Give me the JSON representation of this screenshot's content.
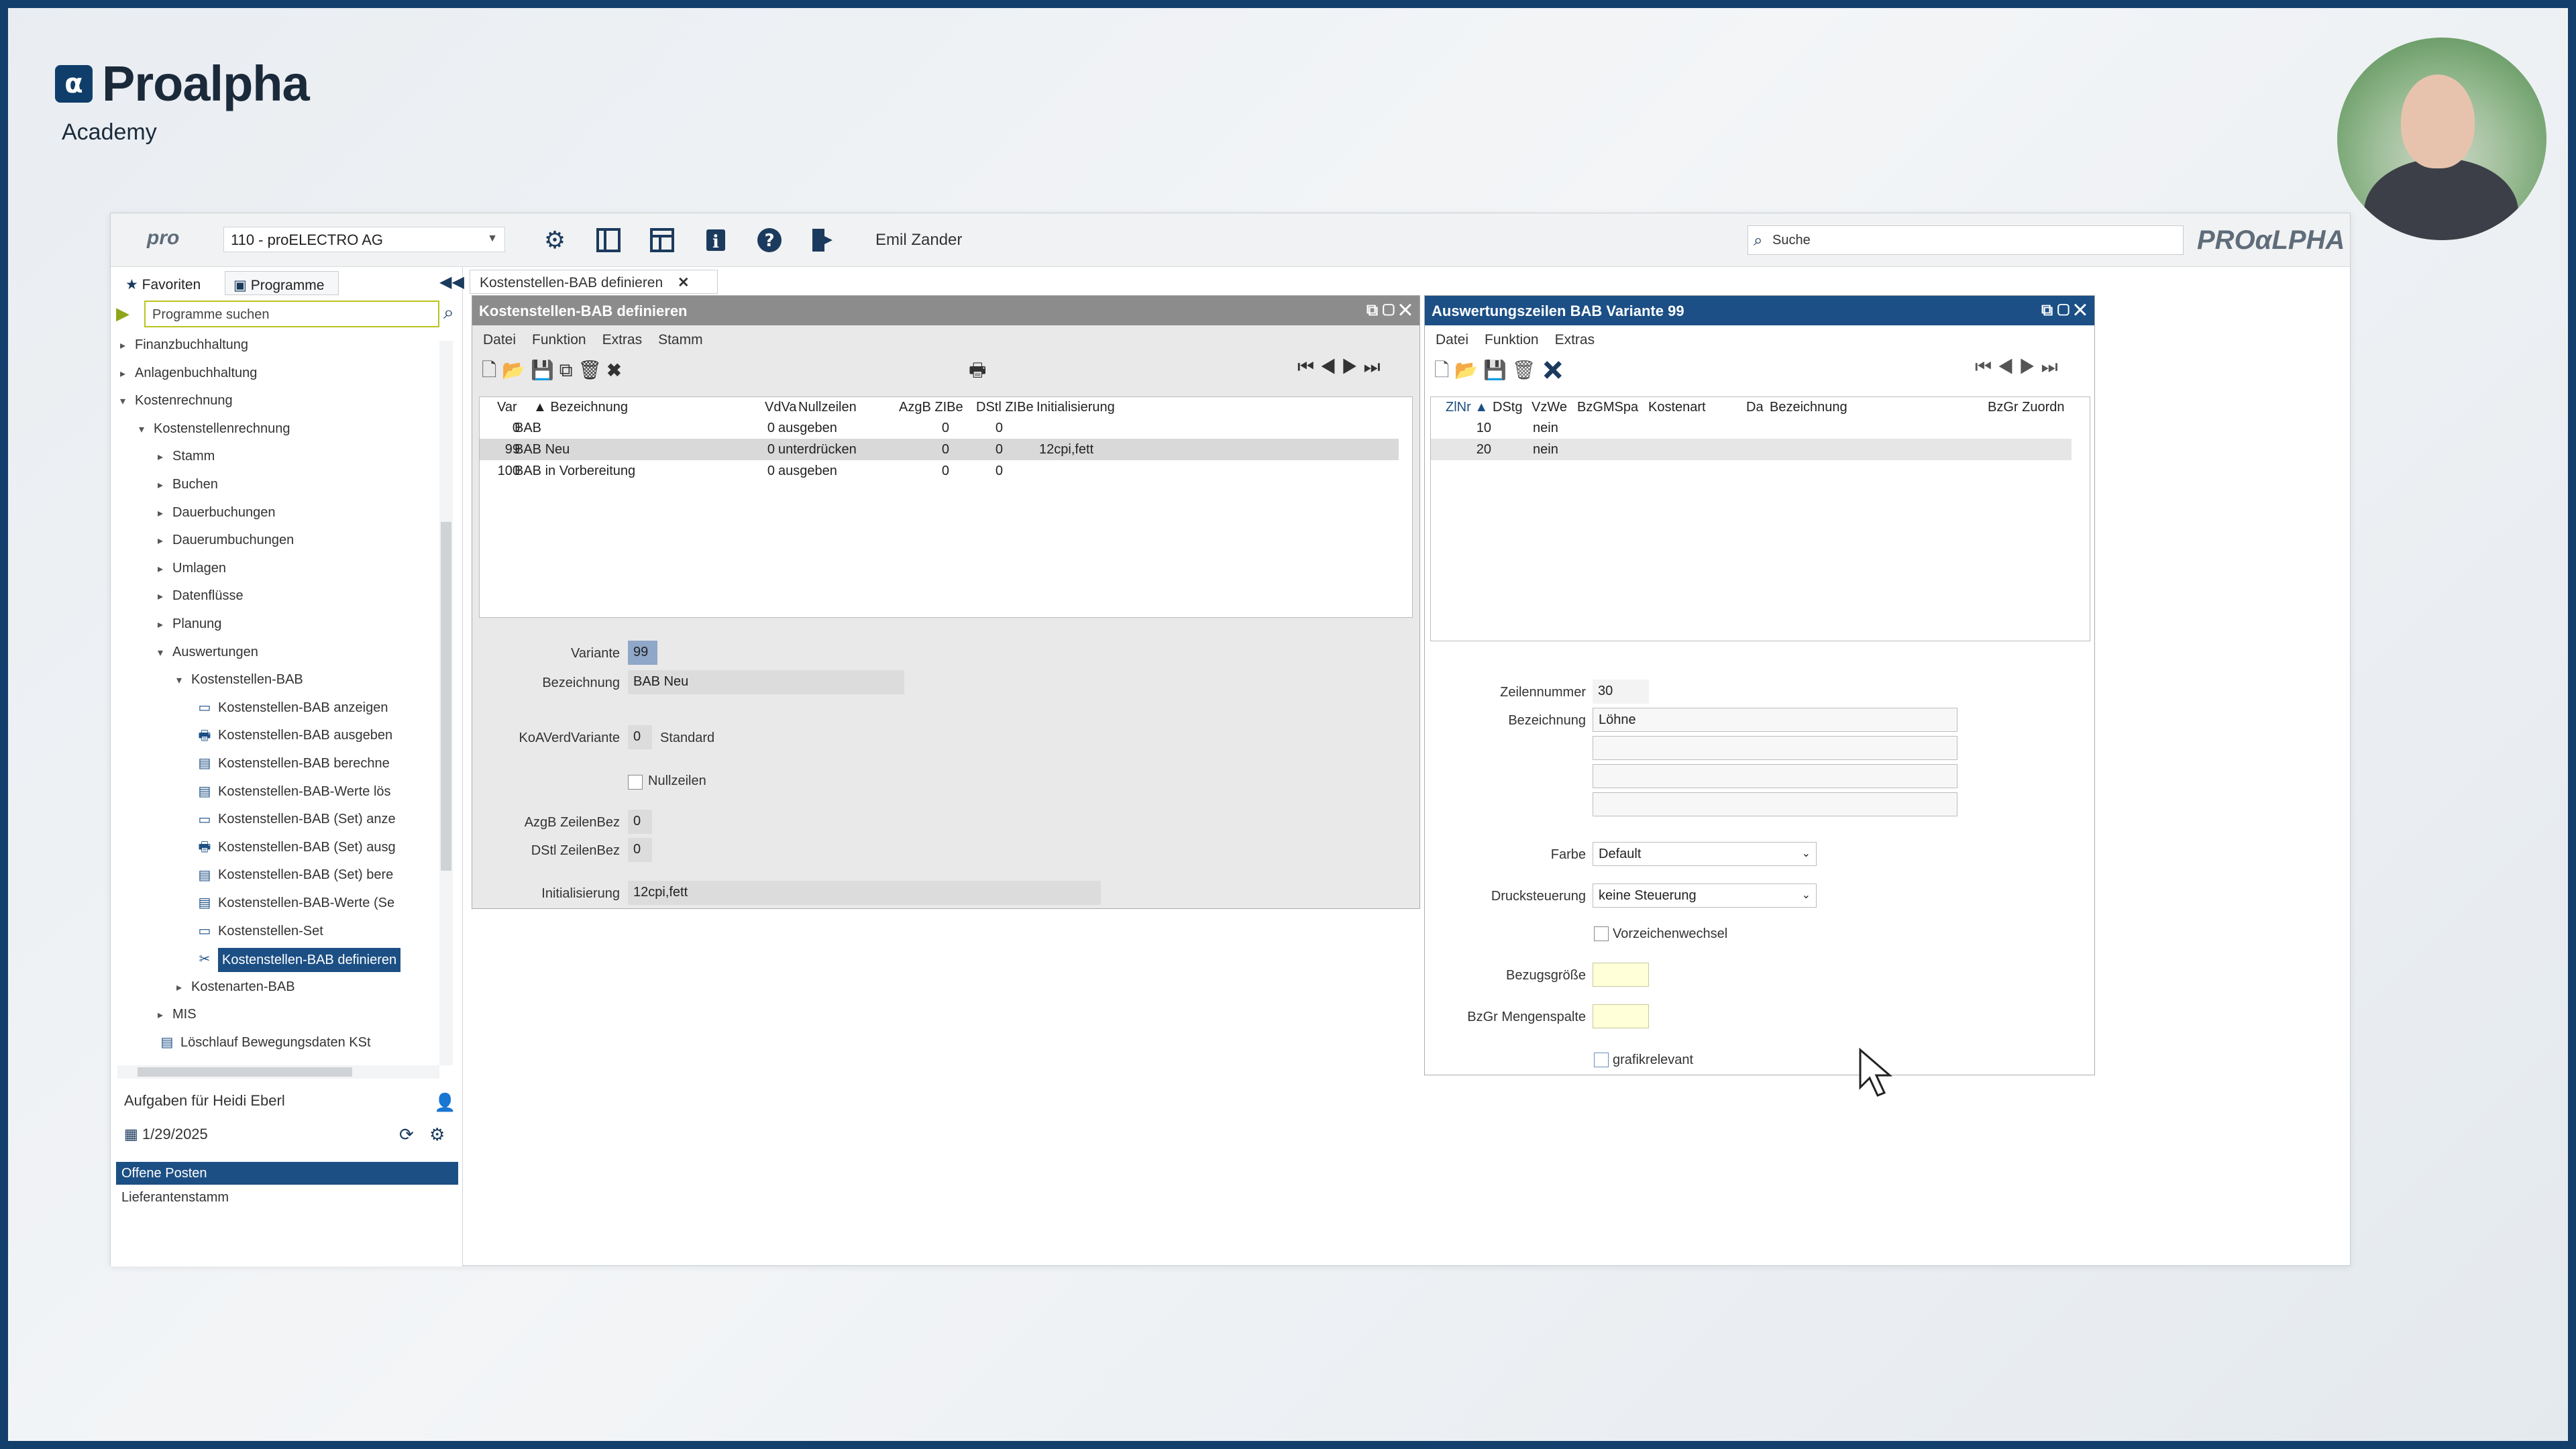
{
  "branding": {
    "logo_text": "Proalpha",
    "logo_mark": "α",
    "subtitle": "Academy"
  },
  "app": {
    "logo_small": "pro",
    "company": "110 - proELECTRO AG",
    "user": "Emil Zander",
    "search_placeholder": "Suche",
    "brand": "PROαLPHA",
    "icons": [
      "gear-icon",
      "panel-icon",
      "layout-icon",
      "info-icon",
      "help-icon",
      "exit-icon"
    ]
  },
  "sidebar": {
    "tabs": [
      "Favoriten",
      "Programme"
    ],
    "search_placeholder": "Programme suchen",
    "tree": [
      {
        "label": "Finanzbuchhaltung",
        "level": 0,
        "arrow": "▸"
      },
      {
        "label": "Anlagenbuchhaltung",
        "level": 0,
        "arrow": "▸"
      },
      {
        "label": "Kostenrechnung",
        "level": 0,
        "arrow": "▾"
      },
      {
        "label": "Kostenstellenrechnung",
        "level": 1,
        "arrow": "▾"
      },
      {
        "label": "Stamm",
        "level": 2,
        "arrow": "▸"
      },
      {
        "label": "Buchen",
        "level": 2,
        "arrow": "▸"
      },
      {
        "label": "Dauerbuchungen",
        "level": 2,
        "arrow": "▸"
      },
      {
        "label": "Dauerumbuchungen",
        "level": 2,
        "arrow": "▸"
      },
      {
        "label": "Umlagen",
        "level": 2,
        "arrow": "▸"
      },
      {
        "label": "Datenflüsse",
        "level": 2,
        "arrow": "▸"
      },
      {
        "label": "Planung",
        "level": 2,
        "arrow": "▸"
      },
      {
        "label": "Auswertungen",
        "level": 2,
        "arrow": "▾"
      },
      {
        "label": "Kostenstellen-BAB",
        "level": 3,
        "arrow": "▾"
      },
      {
        "label": "Kostenstellen-BAB anzeigen",
        "level": 4,
        "icon": "window-icon"
      },
      {
        "label": "Kostenstellen-BAB ausgeben",
        "level": 4,
        "icon": "printer-icon"
      },
      {
        "label": "Kostenstellen-BAB berechne",
        "level": 4,
        "icon": "calc-icon"
      },
      {
        "label": "Kostenstellen-BAB-Werte lös",
        "level": 4,
        "icon": "calc-icon"
      },
      {
        "label": "Kostenstellen-BAB (Set) anze",
        "level": 4,
        "icon": "window-icon"
      },
      {
        "label": "Kostenstellen-BAB (Set) ausg",
        "level": 4,
        "icon": "printer-icon"
      },
      {
        "label": "Kostenstellen-BAB (Set) bere",
        "level": 4,
        "icon": "calc-icon"
      },
      {
        "label": "Kostenstellen-BAB-Werte (Se",
        "level": 4,
        "icon": "calc-icon"
      },
      {
        "label": "Kostenstellen-Set",
        "level": 4,
        "icon": "window-icon"
      },
      {
        "label": "Kostenstellen-BAB definieren",
        "level": 4,
        "icon": "tools-icon",
        "selected": true
      },
      {
        "label": "Kostenarten-BAB",
        "level": 3,
        "arrow": "▸"
      },
      {
        "label": "MIS",
        "level": 2,
        "arrow": "▸"
      },
      {
        "label": "Löschlauf Bewegungsdaten KSt",
        "level": 2,
        "icon": "calc-icon"
      }
    ],
    "tasks_title": "Aufgaben für Heidi Eberl",
    "tasks_date": "1/29/2025",
    "task_items": [
      "Offene Posten",
      "Lieferantenstamm"
    ]
  },
  "module_tab": "Kostenstellen-BAB definieren",
  "left_panel": {
    "title": "Kostenstellen-BAB definieren",
    "menu": [
      "Datei",
      "Funktion",
      "Extras",
      "Stamm"
    ],
    "columns": [
      "Var",
      "Bezeichnung",
      "VdVa",
      "Nullzeilen",
      "AzgB ZIBe",
      "DStl ZIBe",
      "Initialisierung"
    ],
    "rows": [
      {
        "var": "0",
        "bez": "BAB",
        "vdva": "0",
        "null": "ausgeben",
        "azgb": "0",
        "dstl": "0",
        "init": ""
      },
      {
        "var": "99",
        "bez": "BAB Neu",
        "vdva": "0",
        "null": "unterdrücken",
        "azgb": "0",
        "dstl": "0",
        "init": "12cpi,fett"
      },
      {
        "var": "100",
        "bez": "BAB in Vorbereitung",
        "vdva": "0",
        "null": "ausgeben",
        "azgb": "0",
        "dstl": "0",
        "init": ""
      }
    ],
    "form": {
      "variante_label": "Variante",
      "variante": "99",
      "bez_label": "Bezeichnung",
      "bez": "BAB Neu",
      "koa_label": "KoAVerdVariante",
      "koa": "0",
      "koa_text": "Standard",
      "null_label": "Nullzeilen",
      "azgb_label": "AzgB ZeilenBez",
      "azgb": "0",
      "dstl_label": "DStl ZeilenBez",
      "dstl": "0",
      "init_label": "Initialisierung",
      "init": "12cpi,fett"
    }
  },
  "right_panel": {
    "title": "Auswertungszeilen BAB Variante 99",
    "menu": [
      "Datei",
      "Funktion",
      "Extras"
    ],
    "columns": [
      "ZlNr",
      "DStg",
      "VzWe",
      "BzGMSpa",
      "Kostenart",
      "Da",
      "Bezeichnung",
      "BzGr Zuordn"
    ],
    "rows": [
      {
        "nr": "10",
        "vzwe": "nein"
      },
      {
        "nr": "20",
        "vzwe": "nein"
      }
    ],
    "form": {
      "zeilen_label": "Zeilennummer",
      "zeilen": "30",
      "bez_label": "Bezeichnung",
      "bez": "Löhne",
      "farbe_label": "Farbe",
      "farbe": "Default",
      "druck_label": "Drucksteuerung",
      "druck": "keine Steuerung",
      "vorz_label": "Vorzeichenwechsel",
      "bezug_label": "Bezugsgröße",
      "bzgr_label": "BzGr Mengenspalte",
      "grafik_label": "grafikrelevant"
    }
  },
  "colors": {
    "accent": "#1c4f84",
    "title_inactive": "#8c8c8c",
    "title_active": "#1b4f86",
    "lime": "#b8c41f"
  }
}
